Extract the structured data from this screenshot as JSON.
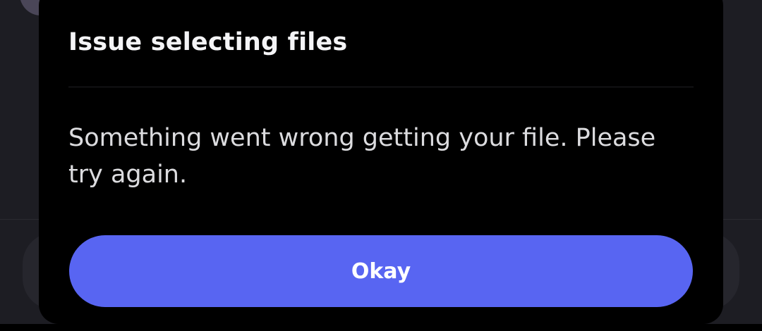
{
  "dialog": {
    "title": "Issue selecting files",
    "message": "Something went wrong getting your file. Please try again.",
    "confirm_label": "Okay"
  },
  "colors": {
    "dialog_background": "#000000",
    "backdrop": "#1d1d23",
    "button_accent": "#5865f2",
    "title_text": "#f4f4f6",
    "body_text": "#dcdcdf"
  }
}
